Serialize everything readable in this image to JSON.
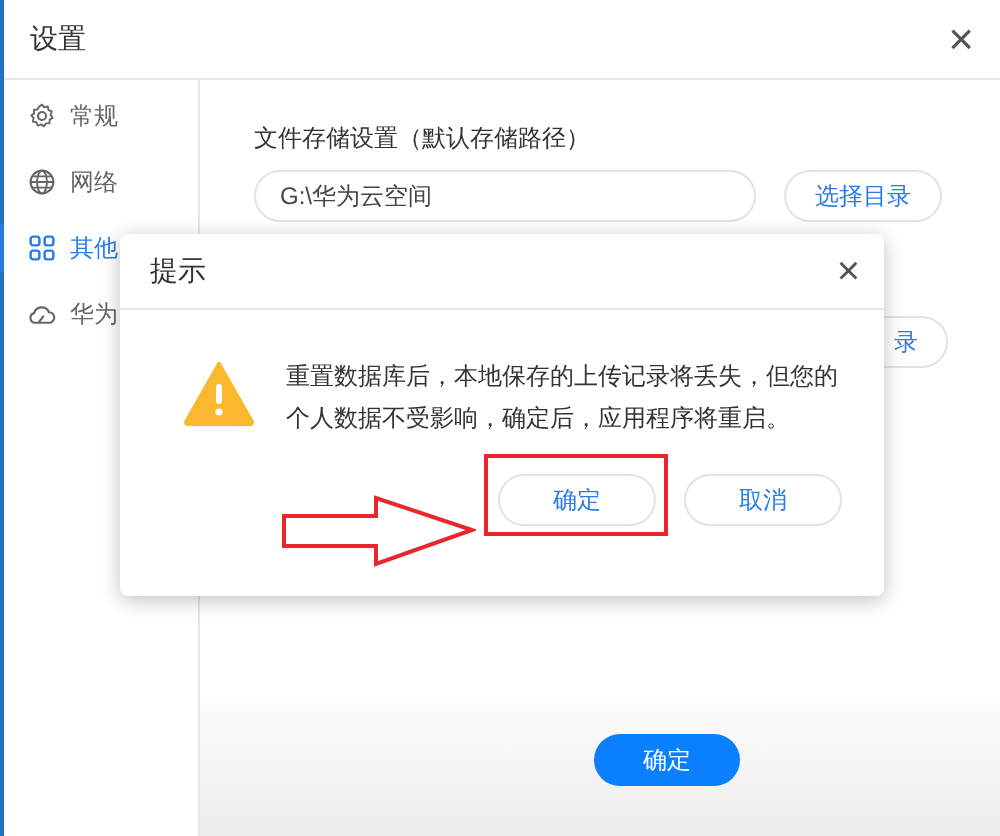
{
  "window": {
    "title": "设置",
    "close": "×"
  },
  "sidebar": {
    "items": [
      {
        "label": "常规",
        "selected": false
      },
      {
        "label": "网络",
        "selected": false
      },
      {
        "label": "其他",
        "selected": true
      },
      {
        "label": "华为",
        "selected": false
      }
    ]
  },
  "storage": {
    "label": "文件存储设置（默认存储路径）",
    "path": "G:\\华为云空间",
    "button": "选择目录"
  },
  "second_row": {
    "button": "录"
  },
  "footer": {
    "confirm": "确定"
  },
  "dialog": {
    "title": "提示",
    "close": "×",
    "message": "重置数据库后，本地保存的上传记录将丢失，但您的个人数据不受影响，确定后，应用程序将重启。",
    "buttons": [
      {
        "label": "确定",
        "highlighted": true
      },
      {
        "label": "取消",
        "highlighted": false
      }
    ]
  }
}
